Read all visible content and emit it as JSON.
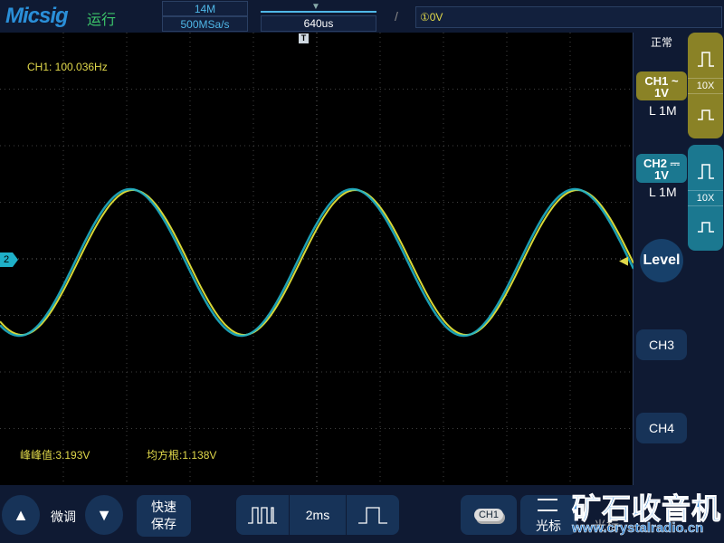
{
  "header": {
    "brand": "Micsig",
    "run_state": "运行",
    "memory_depth": "14M",
    "sample_rate": "500MSa/s",
    "time_delay": "640us",
    "trigger_edge": "/",
    "trigger_level": "①0V"
  },
  "screen": {
    "ch1_frequency": "CH1: 100.036Hz",
    "peak_to_peak": "峰峰值:3.193V",
    "rms": "均方根:1.138V",
    "ch2_marker": "2",
    "trigger_marker": "T"
  },
  "waveform": {
    "cycles_visible": 2.85,
    "ch1_color": "#d8d838",
    "ch2_color": "#1fb0c8",
    "grid_color": "#555555"
  },
  "right_panel": {
    "acq_mode": "正常",
    "ch1": {
      "label": "CH1",
      "coupling": "~",
      "scale": "1V",
      "impedance": "L 1M",
      "probe": "10X",
      "color": "#8a8226"
    },
    "ch2": {
      "label": "CH2",
      "coupling": "⎓",
      "scale": "1V",
      "impedance": "L 1M",
      "probe": "10X",
      "color": "#1b7890"
    },
    "level": "Level",
    "ch3": "CH3",
    "ch4": "CH4"
  },
  "bottom": {
    "fine_adjust": "微调",
    "quick_save_1": "快速",
    "quick_save_2": "保存",
    "timebase": "2ms",
    "ch_select": "CH1",
    "cursor": "光标",
    "cursor2": "光标"
  },
  "watermark": {
    "title": "矿石收音机",
    "url": "www.crystalradio.cn"
  }
}
